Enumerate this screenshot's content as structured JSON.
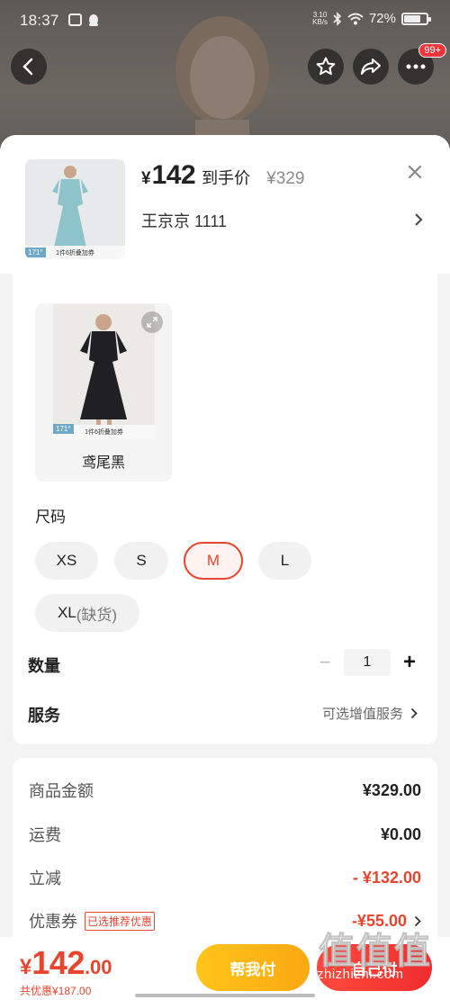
{
  "status_bar": {
    "time": "18:37",
    "speed_top": "3.10",
    "speed_bottom": "KB/s",
    "battery": "72%"
  },
  "nav": {
    "back": "back-icon",
    "favorite": "star-icon",
    "share": "share-icon",
    "more": "more-icon",
    "more_badge": "99+"
  },
  "header": {
    "yen": "¥",
    "price": "142",
    "price_label": "到手价",
    "original_price": "¥329",
    "address": "王京京  1111",
    "thumb_tag": "171°",
    "thumb_bar": "1件6折叠加券"
  },
  "colors_section": {
    "swatch_label": "鸢尾黑",
    "swatch_tag": "171°",
    "swatch_bar": "1件6折叠加券"
  },
  "size_section": {
    "label": "尺码",
    "sizes": [
      {
        "label": "XS"
      },
      {
        "label": "S"
      },
      {
        "label": "M",
        "selected": true
      },
      {
        "label": "L"
      },
      {
        "label": "XL",
        "note": "(缺货)"
      }
    ]
  },
  "quantity": {
    "label": "数量",
    "value": "1",
    "minus": "−",
    "plus": "+"
  },
  "service": {
    "label": "服务",
    "link": "可选增值服务"
  },
  "summary": {
    "goods_label": "商品金额",
    "goods_value": "¥329.00",
    "shipping_label": "运费",
    "shipping_value": "¥0.00",
    "discount_label": "立减",
    "discount_value": "- ¥132.00",
    "coupon_label": "优惠券",
    "coupon_tag": "已选推荐优惠",
    "coupon_value": "-¥55.00"
  },
  "bottom": {
    "yen": "¥",
    "total_int": "142",
    "total_dec": ".00",
    "saving": "共优惠¥187.00",
    "help_pay": "帮我付",
    "self_pay": "自己付"
  },
  "watermark": {
    "text": "值值值",
    "url": "zhizhizhi.com"
  },
  "colors": {
    "accent_red": "#e8452f",
    "yellow": "#ffc519",
    "button_red": "#f02d2d"
  }
}
